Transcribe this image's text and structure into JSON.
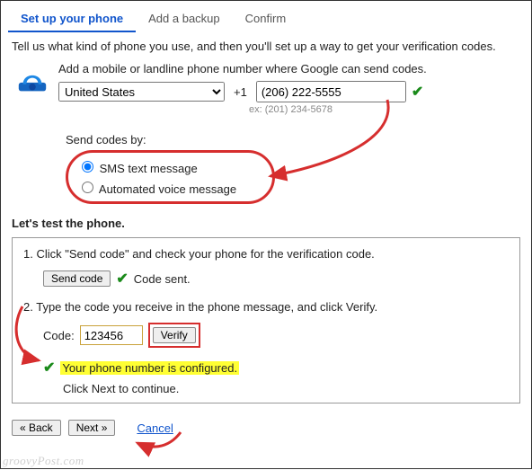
{
  "tabs": {
    "setup": "Set up your phone",
    "backup": "Add a backup",
    "confirm": "Confirm"
  },
  "intro": "Tell us what kind of phone you use, and then you'll set up a way to get your verification codes.",
  "phone": {
    "instruction": "Add a mobile or landline phone number where Google can send codes.",
    "country": "United States",
    "cc": "+1",
    "number": "(206) 222-5555",
    "example": "ex: (201) 234-5678"
  },
  "send_by": {
    "label": "Send codes by:",
    "sms": "SMS text message",
    "voice": "Automated voice message"
  },
  "test": {
    "heading": "Let's test the phone.",
    "step1": "1. Click \"Send code\" and check your phone for the verification code.",
    "send_btn": "Send code",
    "sent_msg": "Code sent.",
    "step2": "2. Type the code you receive in the phone message, and click Verify.",
    "code_label": "Code:",
    "code_value": "123456",
    "verify_btn": "Verify",
    "configured": "Your phone number is configured.",
    "continue": "Click Next to continue."
  },
  "nav": {
    "back": "« Back",
    "next": "Next »",
    "cancel": "Cancel"
  },
  "watermark": "groovyPost.com"
}
